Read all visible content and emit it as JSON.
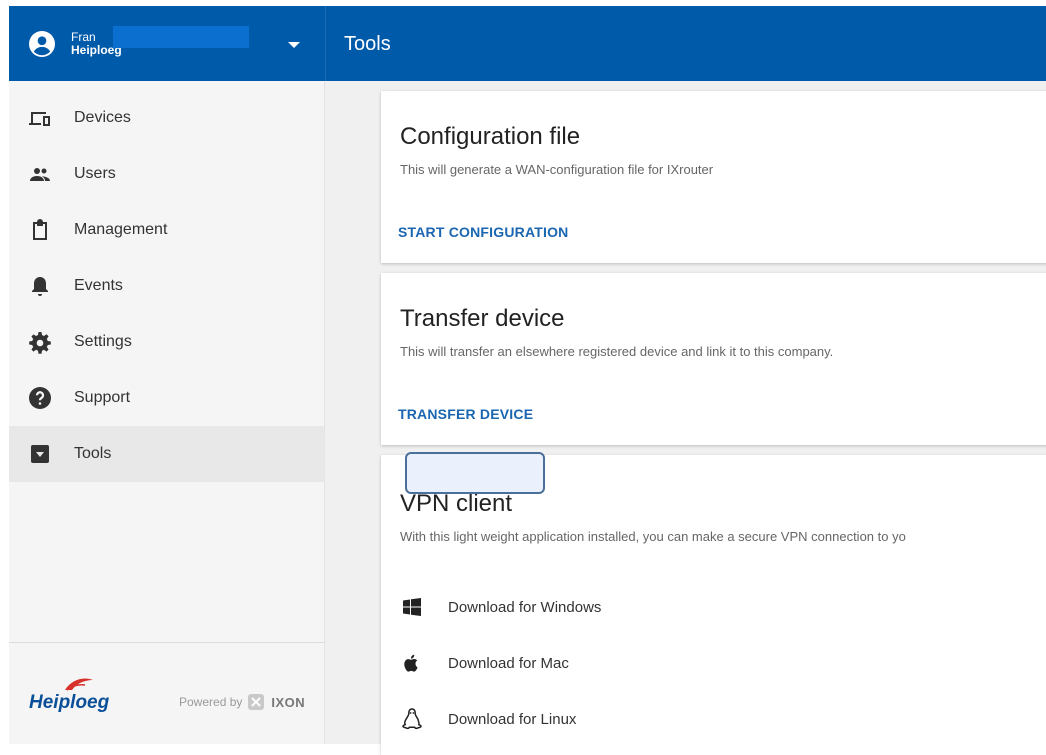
{
  "account": {
    "first_name": "Fran",
    "last_name": "Heiploeg"
  },
  "appbar": {
    "title": "Tools"
  },
  "sidebar": {
    "items": [
      {
        "label": "Devices",
        "icon": "devices-icon"
      },
      {
        "label": "Users",
        "icon": "users-icon"
      },
      {
        "label": "Management",
        "icon": "clipboard-icon"
      },
      {
        "label": "Events",
        "icon": "bell-icon"
      },
      {
        "label": "Settings",
        "icon": "gear-icon"
      },
      {
        "label": "Support",
        "icon": "help-icon"
      },
      {
        "label": "Tools",
        "icon": "archive-icon",
        "active": true
      }
    ],
    "footer": {
      "logo_text": "Heiploeg",
      "powered_by": "Powered by",
      "ixon": "IXON"
    }
  },
  "cards": {
    "config": {
      "title": "Configuration file",
      "description": "This will generate a WAN-configuration file for IXrouter",
      "action": "START CONFIGURATION"
    },
    "transfer": {
      "title": "Transfer device",
      "description": "This will transfer an elsewhere registered device and link it to this company.",
      "action": "TRANSFER DEVICE"
    },
    "vpn": {
      "title": "VPN client",
      "description": "With this light weight application installed, you can make a secure VPN connection to yo",
      "downloads": [
        {
          "label": "Download for Windows",
          "icon": "windows-icon"
        },
        {
          "label": "Download for Mac",
          "icon": "apple-icon"
        },
        {
          "label": "Download for Linux",
          "icon": "linux-icon"
        }
      ]
    }
  },
  "colors": {
    "primary": "#005aaa",
    "link": "#1a66b0",
    "sidebar_bg": "#f5f5f5",
    "content_bg": "#f0f0f0"
  }
}
